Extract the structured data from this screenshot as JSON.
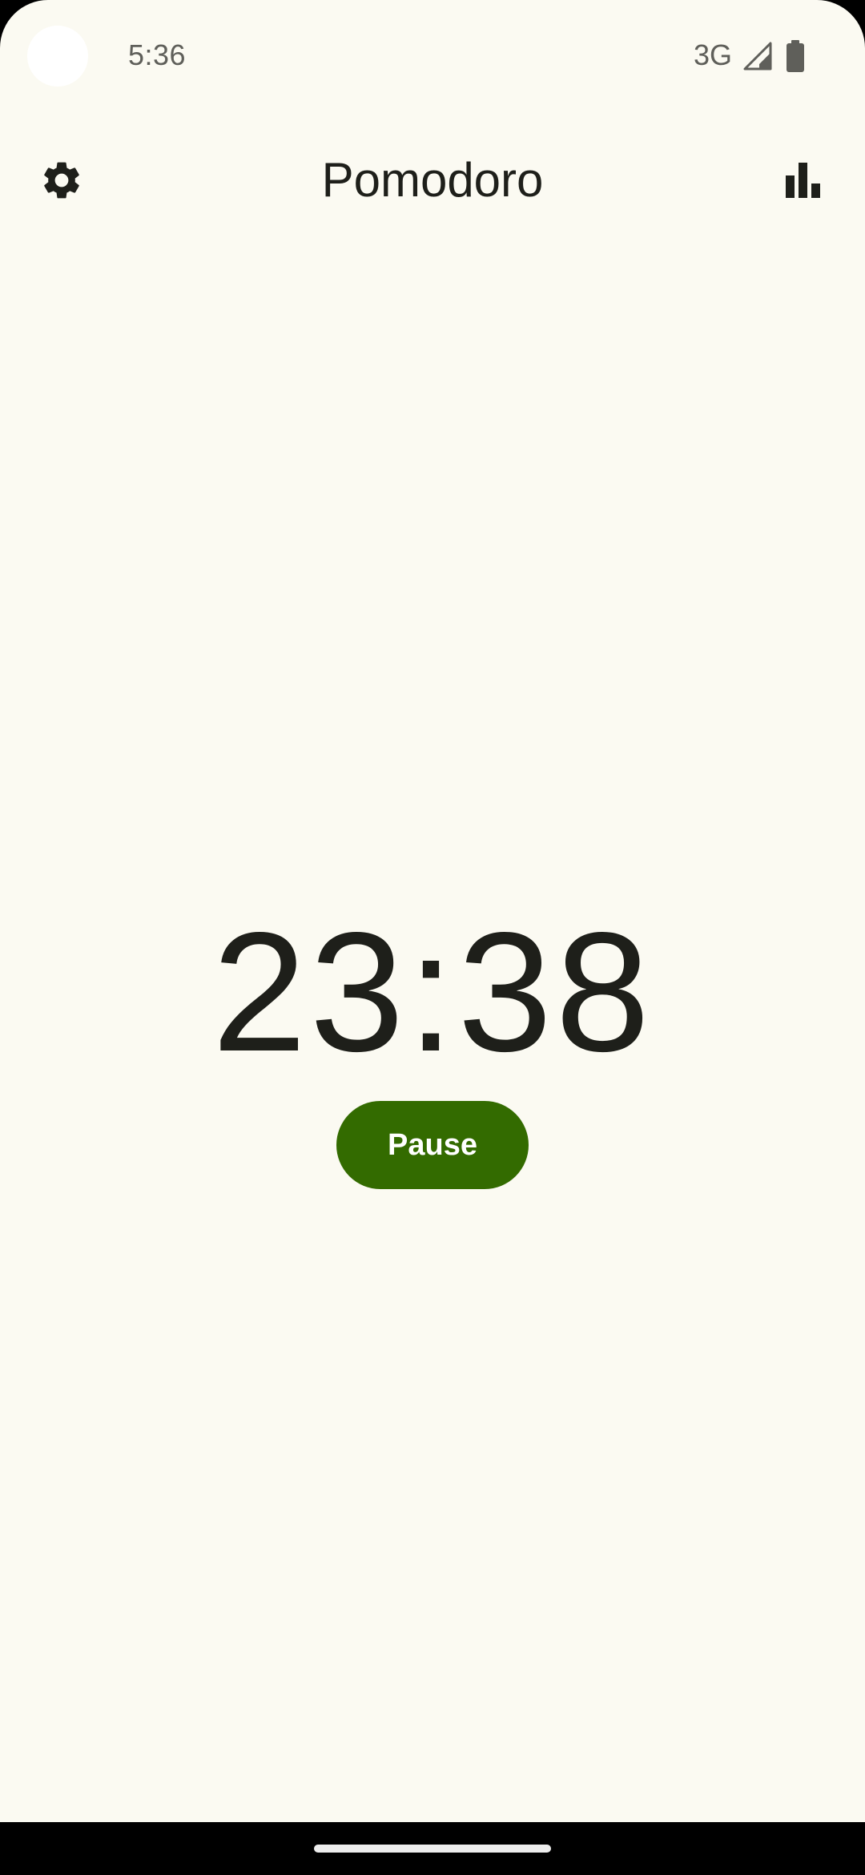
{
  "status_bar": {
    "time": "5:36",
    "network": "3G",
    "icons": [
      "signal-icon",
      "battery-icon"
    ]
  },
  "app_bar": {
    "title": "Pomodoro",
    "left_icon": "gear-icon",
    "right_icon": "bar-chart-icon"
  },
  "timer": {
    "display": "23:38"
  },
  "controls": {
    "pause_label": "Pause"
  },
  "colors": {
    "background": "#FBFAF2",
    "accent": "#336B00",
    "text": "#1E1F1A",
    "status_text": "#5F5F5A"
  }
}
